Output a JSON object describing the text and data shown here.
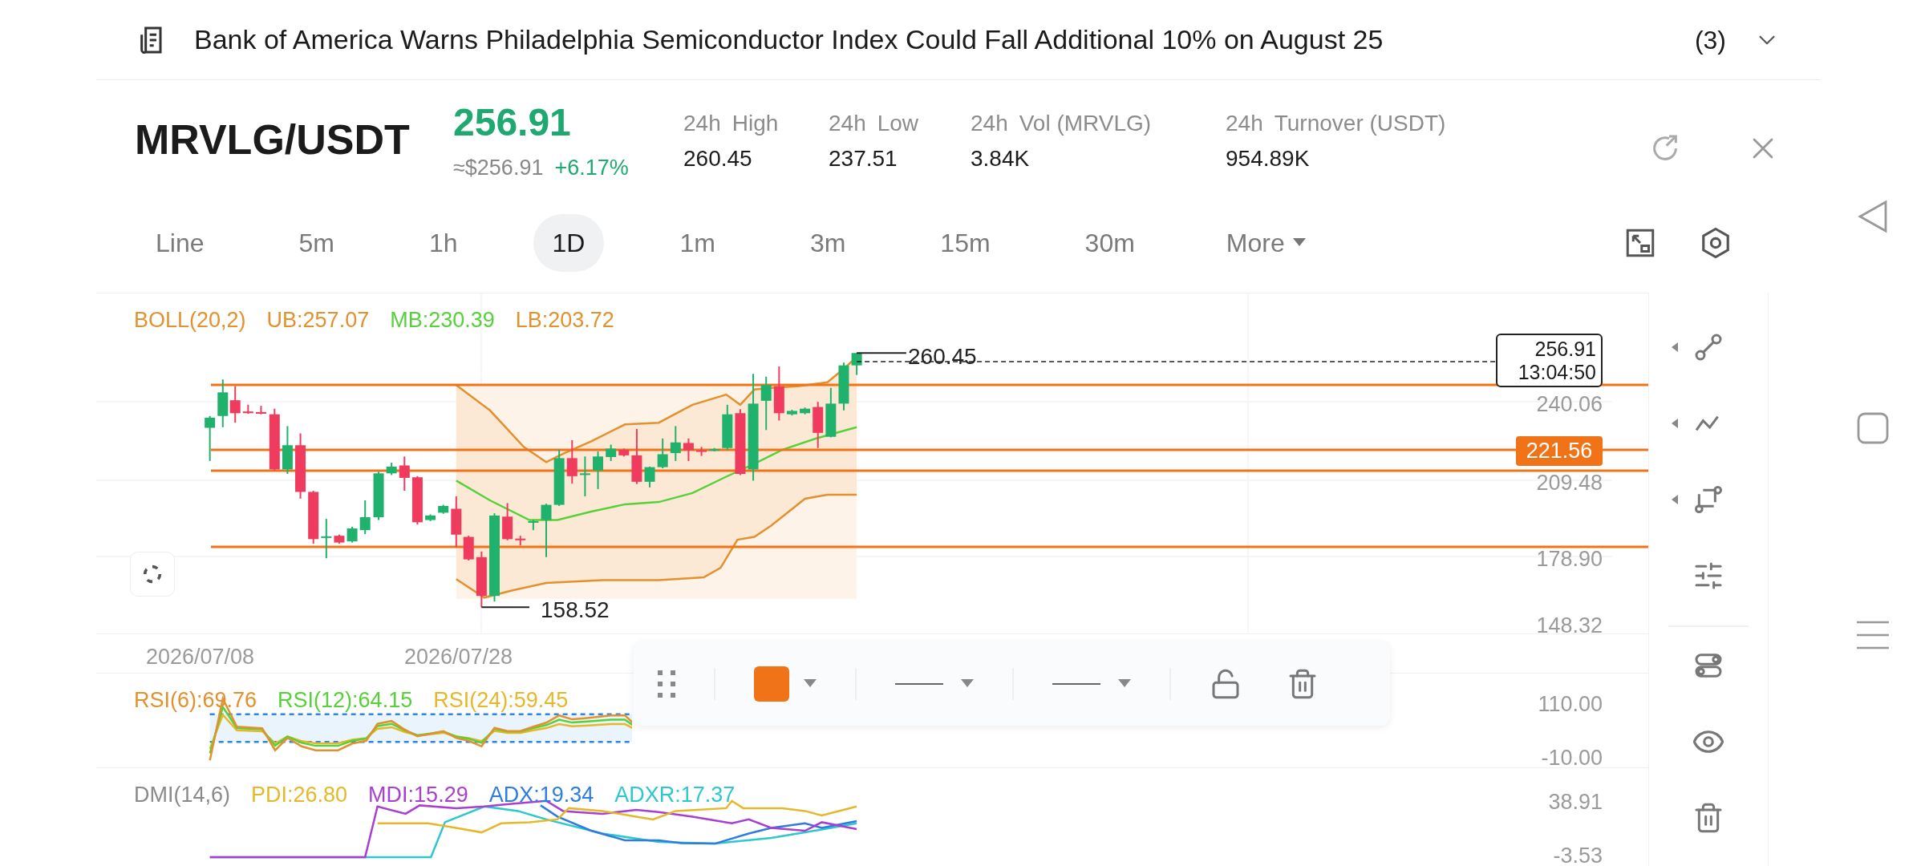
{
  "headline": {
    "text": "Bank of America Warns Philadelphia Semiconductor Index Could Fall Additional 10% on August 25",
    "count": "(3)"
  },
  "ticker": {
    "symbol": "MRVLG/USDT",
    "price": "256.91",
    "price_usd": "≈$256.91",
    "change": "+6.17%",
    "stats": [
      {
        "period": "24h",
        "label": "High",
        "value": "260.45"
      },
      {
        "period": "24h",
        "label": "Low",
        "value": "237.51"
      },
      {
        "period": "24h",
        "label": "Vol (MRVLG)",
        "value": "3.84K"
      },
      {
        "period": "24h",
        "label": "Turnover (USDT)",
        "value": "954.89K"
      }
    ]
  },
  "intervals": {
    "tabs": [
      {
        "label": "Line",
        "selected": false
      },
      {
        "label": "5m",
        "selected": false
      },
      {
        "label": "1h",
        "selected": false
      },
      {
        "label": "1D",
        "selected": true
      },
      {
        "label": "1m",
        "selected": false
      },
      {
        "label": "3m",
        "selected": false
      },
      {
        "label": "15m",
        "selected": false
      },
      {
        "label": "30m",
        "selected": false
      }
    ],
    "more": "More"
  },
  "main_chart": {
    "legend": [
      {
        "text": "BOLL(20,2)",
        "color": "#e3912f"
      },
      {
        "text": "UB:257.07",
        "color": "#e3912f"
      },
      {
        "text": "MB:230.39",
        "color": "#57d13a"
      },
      {
        "text": "LB:203.72",
        "color": "#e3912f"
      }
    ],
    "y_axis": [
      "240.06",
      "209.48",
      "178.90",
      "148.32"
    ],
    "high_marker": "260.45",
    "low_marker": "158.52",
    "price_tag": {
      "price": "256.91",
      "countdown": "13:04:50"
    },
    "alert_tag": "221.56",
    "dates": [
      "2026/07/08",
      "2026/07/28"
    ]
  },
  "drawing_toolbar": {
    "color": "#f07318"
  },
  "rsi": {
    "legend": [
      {
        "text": "RSI(6):69.76",
        "color": "#e3912f"
      },
      {
        "text": "RSI(12):64.15",
        "color": "#57d13a"
      },
      {
        "text": "RSI(24):59.45",
        "color": "#e6b829"
      }
    ],
    "y_axis": [
      "110.00",
      "-10.00"
    ]
  },
  "dmi": {
    "legend": [
      {
        "text": "DMI(14,6)",
        "color": "#8a8a8a"
      },
      {
        "text": "PDI:26.80",
        "color": "#e6b829"
      },
      {
        "text": "MDI:15.29",
        "color": "#a83fd1"
      },
      {
        "text": "ADX:19.34",
        "color": "#2f7ce0"
      },
      {
        "text": "ADXR:17.37",
        "color": "#2cc7cf"
      }
    ],
    "y_axis": [
      "38.91",
      "-3.53"
    ]
  }
}
